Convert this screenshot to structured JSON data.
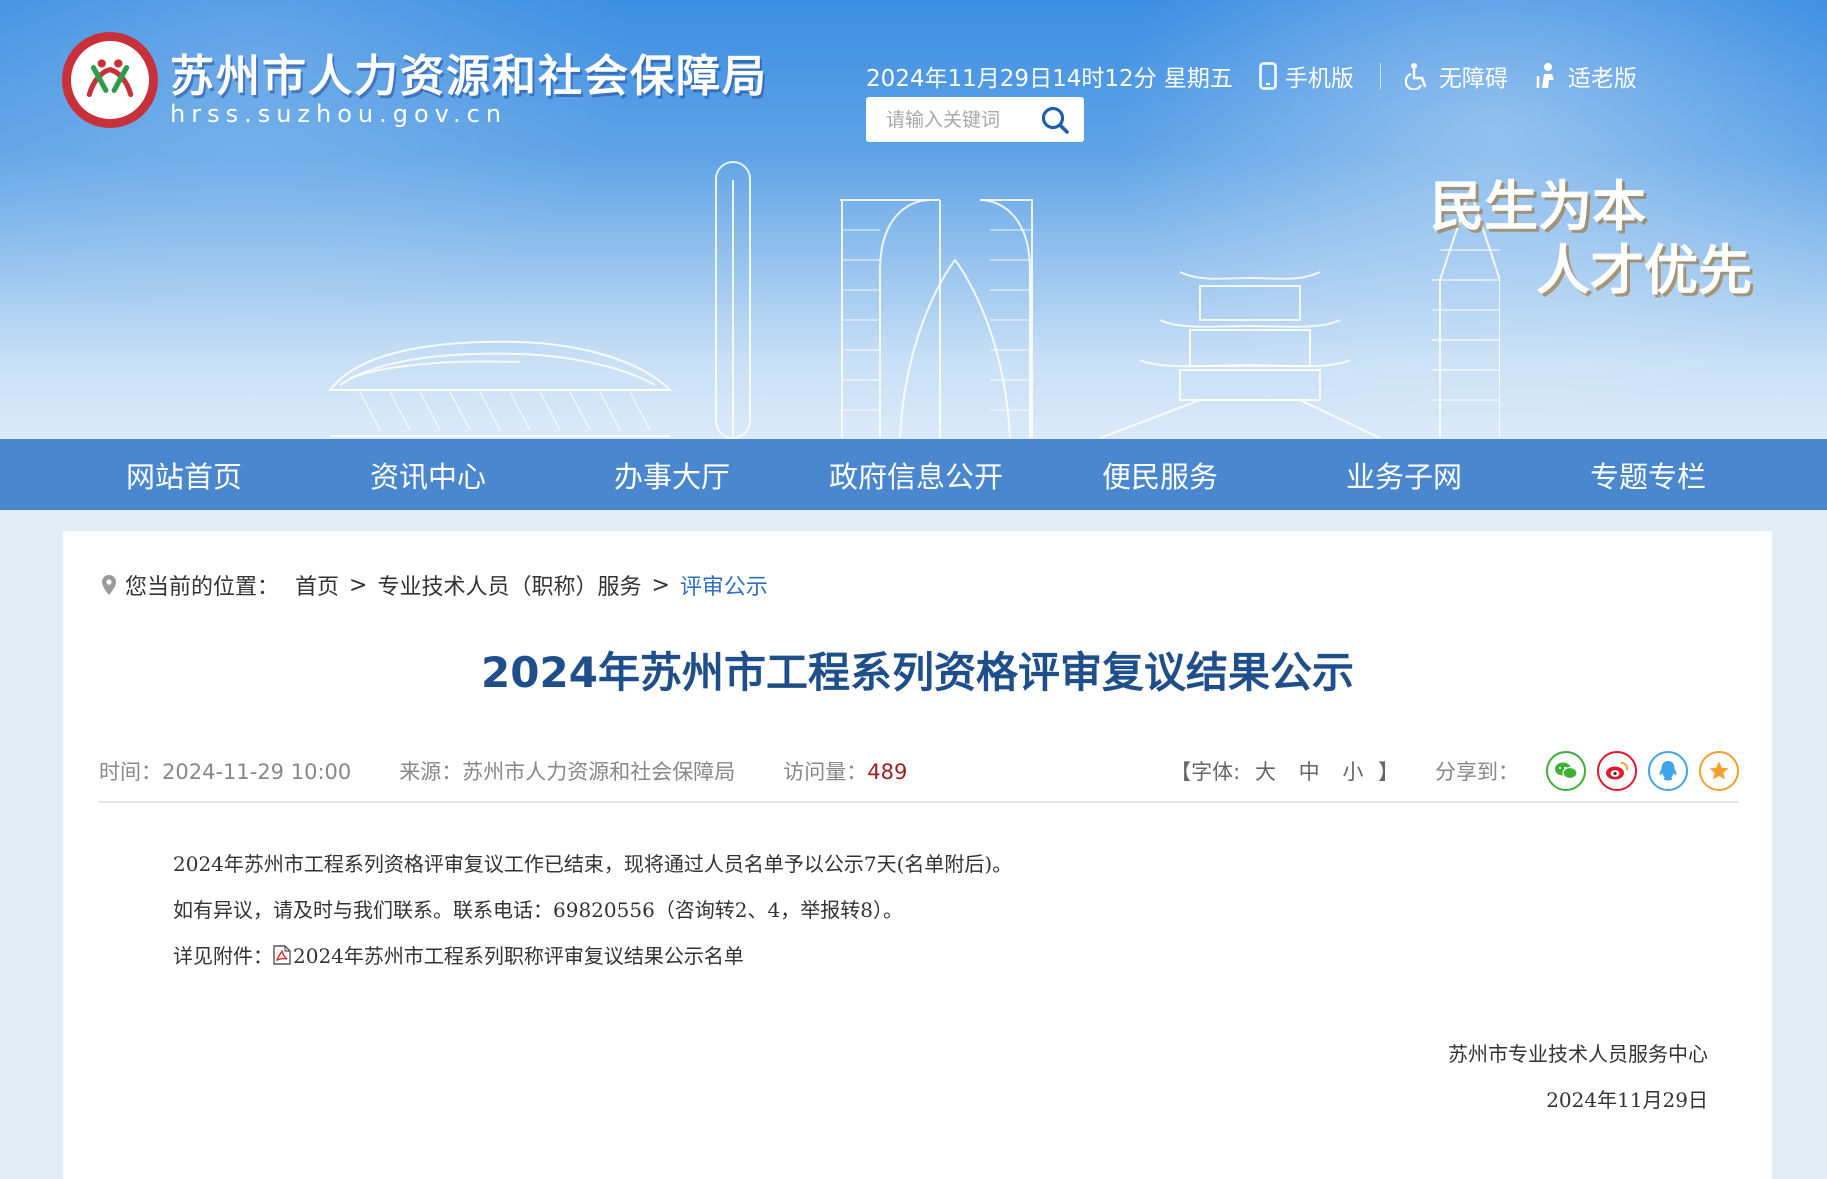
{
  "header": {
    "site_title": "苏州市人力资源和社会保障局",
    "site_domain": "hrss.suzhou.gov.cn",
    "datetime": "2024年11月29日14时12分 星期五",
    "mobile_label": "手机版",
    "accessibility_label": "无障碍",
    "elderly_label": "适老版",
    "search_placeholder": "请输入关键词",
    "slogan_line1": "民生为本",
    "slogan_line2": "人才优先"
  },
  "nav": {
    "items": [
      "网站首页",
      "资讯中心",
      "办事大厅",
      "政府信息公开",
      "便民服务",
      "业务子网",
      "专题专栏"
    ]
  },
  "breadcrumb": {
    "label": "您当前的位置：",
    "items": [
      "首页",
      "专业技术人员（职称）服务",
      "评审公示"
    ],
    "separator": ">"
  },
  "article": {
    "title": "2024年苏州市工程系列资格评审复议结果公示",
    "time_label": "时间：",
    "time_value": "2024-11-29 10:00",
    "source_label": "来源：",
    "source_value": "苏州市人力资源和社会保障局",
    "hits_label": "访问量：",
    "hits_value": "489",
    "font_open": "【字体:",
    "font_large": "大",
    "font_medium": "中",
    "font_small": "小",
    "font_close": "】",
    "share_label": "分享到：",
    "paragraphs": [
      "2024年苏州市工程系列资格评审复议工作已结束，现将通过人员名单予以公示7天(名单附后)。",
      "如有异议，请及时与我们联系。联系电话：69820556（咨询转2、4，举报转8）。"
    ],
    "attachment_label": "详见附件：",
    "attachment_title": "2024年苏州市工程系列职称评审复议结果公示名单",
    "sign_org": "苏州市专业技术人员服务中心",
    "sign_date": "2024年11月29日"
  },
  "colors": {
    "nav_bg": "#4a87cf",
    "title": "#1f4f8a",
    "breadcrumb_current": "#2f6fc0",
    "hits": "#9b1f1f",
    "wechat": "#3eb135",
    "weibo": "#e6162d",
    "qq": "#3fa5e8",
    "favorite": "#f3a02f"
  }
}
